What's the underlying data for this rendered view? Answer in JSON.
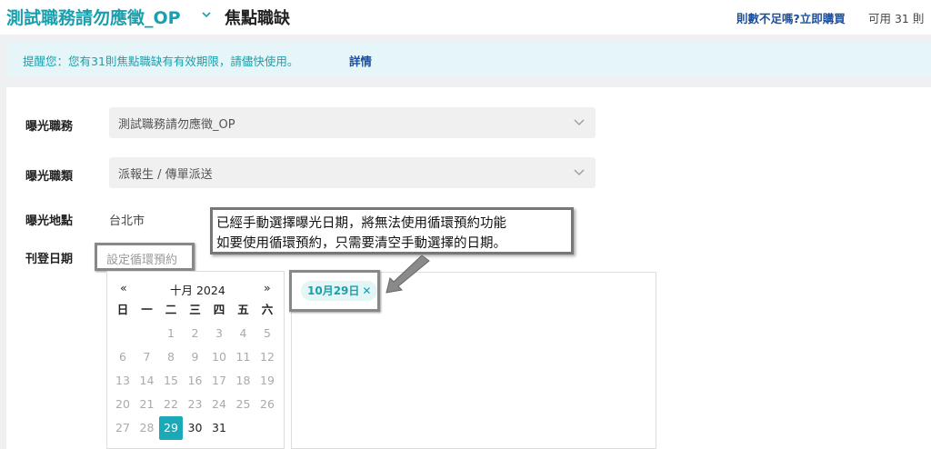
{
  "header": {
    "job_title": "測試職務請勿應徵_OP",
    "page_title": "焦點職缺",
    "buy_link": "則數不足嗎?立即購買",
    "available": "可用 31 則"
  },
  "notice": {
    "text": "提醒您：您有31則焦點職缺有有效期限，請儘快使用。",
    "link": "詳情"
  },
  "form": {
    "job_label": "曝光職務",
    "job_value": "測試職務請勿應徵_OP",
    "category_label": "曝光職類",
    "category_value": "派報生 / 傳單派送",
    "location_label": "曝光地點",
    "location_value": "台北市",
    "date_label": "刊登日期",
    "recurring_placeholder": "設定循環預約"
  },
  "calendar": {
    "prev": "«",
    "next": "»",
    "month_label": "十月 2024",
    "weekdays": [
      "日",
      "一",
      "二",
      "三",
      "四",
      "五",
      "六"
    ],
    "selected_day": "29"
  },
  "selected_dates": {
    "chip_label": "10月29日",
    "remove": "✕"
  },
  "callout": {
    "line1": "已經手動選擇曝光日期，將無法使用循環預約功能",
    "line2": "如要使用循環預約，只需要清空手動選擇的日期。"
  },
  "colors": {
    "accent": "#1aa9b8",
    "link": "#1a4fa0"
  }
}
